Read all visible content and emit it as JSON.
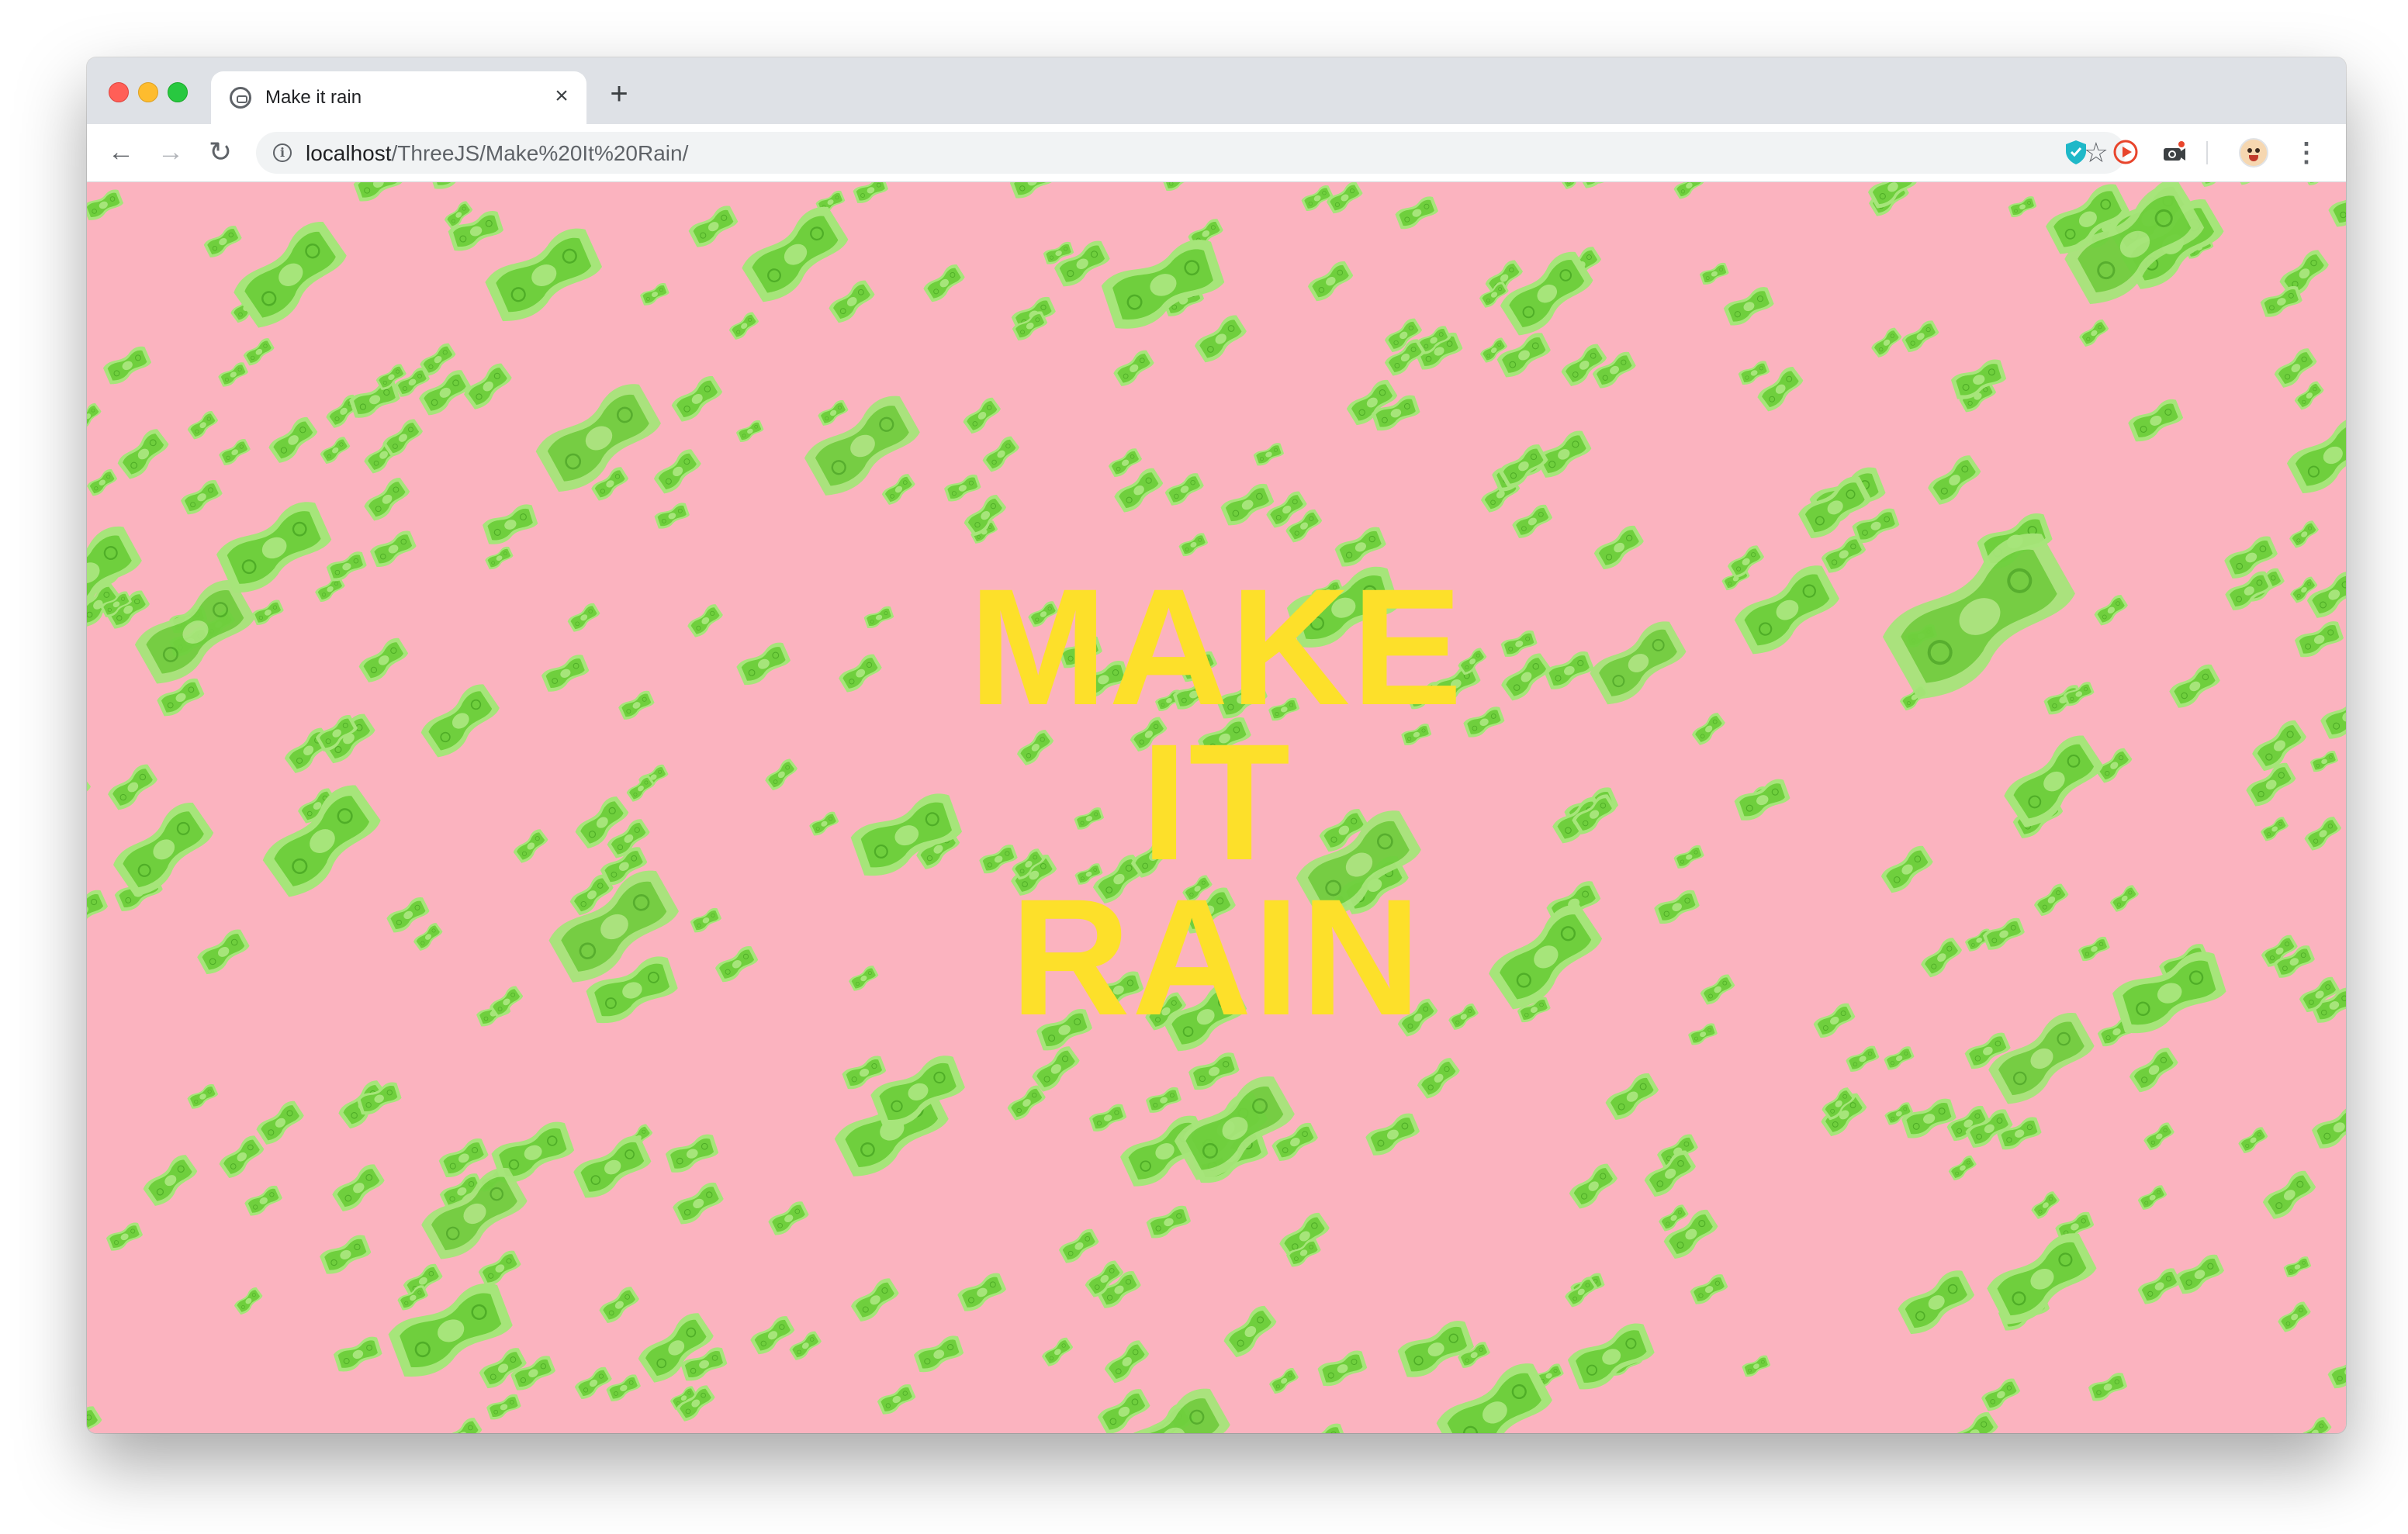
{
  "browser": {
    "tab": {
      "title": "Make it rain",
      "close_glyph": "×",
      "favicon": "globe-icon"
    },
    "new_tab_glyph": "+",
    "nav": {
      "back_glyph": "←",
      "forward_glyph": "→",
      "reload_glyph": "↻"
    },
    "address": {
      "host": "localhost",
      "path": "/ThreeJS/Make%20It%20Rain/",
      "info_glyph": "i"
    },
    "bookmark_glyph": "☆",
    "menu_glyph": "⋮",
    "extensions": [
      "shield-extension-icon",
      "play-extension-icon",
      "camera-extension-icon"
    ]
  },
  "page": {
    "headline": {
      "line1": "MAKE",
      "line2": "IT",
      "line3": "RAIN"
    },
    "colors": {
      "background": "#fbb3bf",
      "headline": "#fde02a",
      "bill_main": "#6fcf3d",
      "bill_light": "#a6e57a",
      "bill_dark": "#4fae27"
    }
  }
}
